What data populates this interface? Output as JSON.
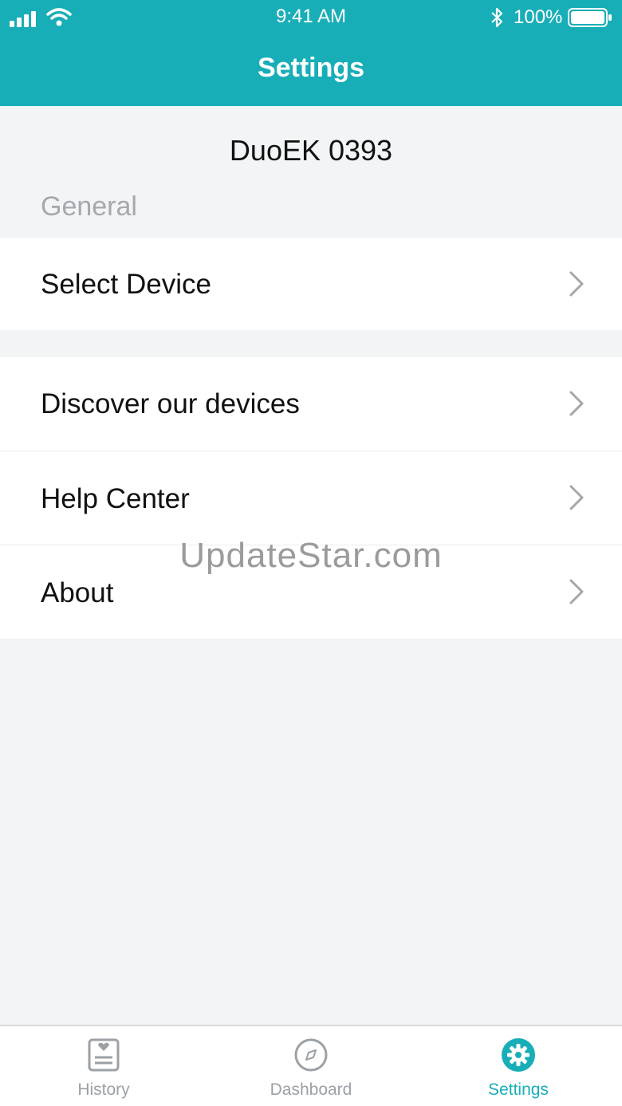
{
  "status_bar": {
    "time": "9:41 AM",
    "battery_percent": "100%"
  },
  "nav": {
    "title": "Settings"
  },
  "device": {
    "name": "DuoEK 0393"
  },
  "sections": {
    "general_label": "General"
  },
  "menu": {
    "select_device": "Select Device",
    "discover": "Discover our devices",
    "help": "Help Center",
    "about": "About"
  },
  "watermark": "UpdateStar.com",
  "tabs": [
    {
      "label": "History",
      "icon": "history-icon",
      "active": false
    },
    {
      "label": "Dashboard",
      "icon": "compass-icon",
      "active": false
    },
    {
      "label": "Settings",
      "icon": "gear-icon",
      "active": true
    }
  ],
  "colors": {
    "accent": "#18aeb8",
    "background": "#f2f4f6",
    "section_label": "#a4a9ae",
    "tab_inactive": "#9ba1a6"
  }
}
